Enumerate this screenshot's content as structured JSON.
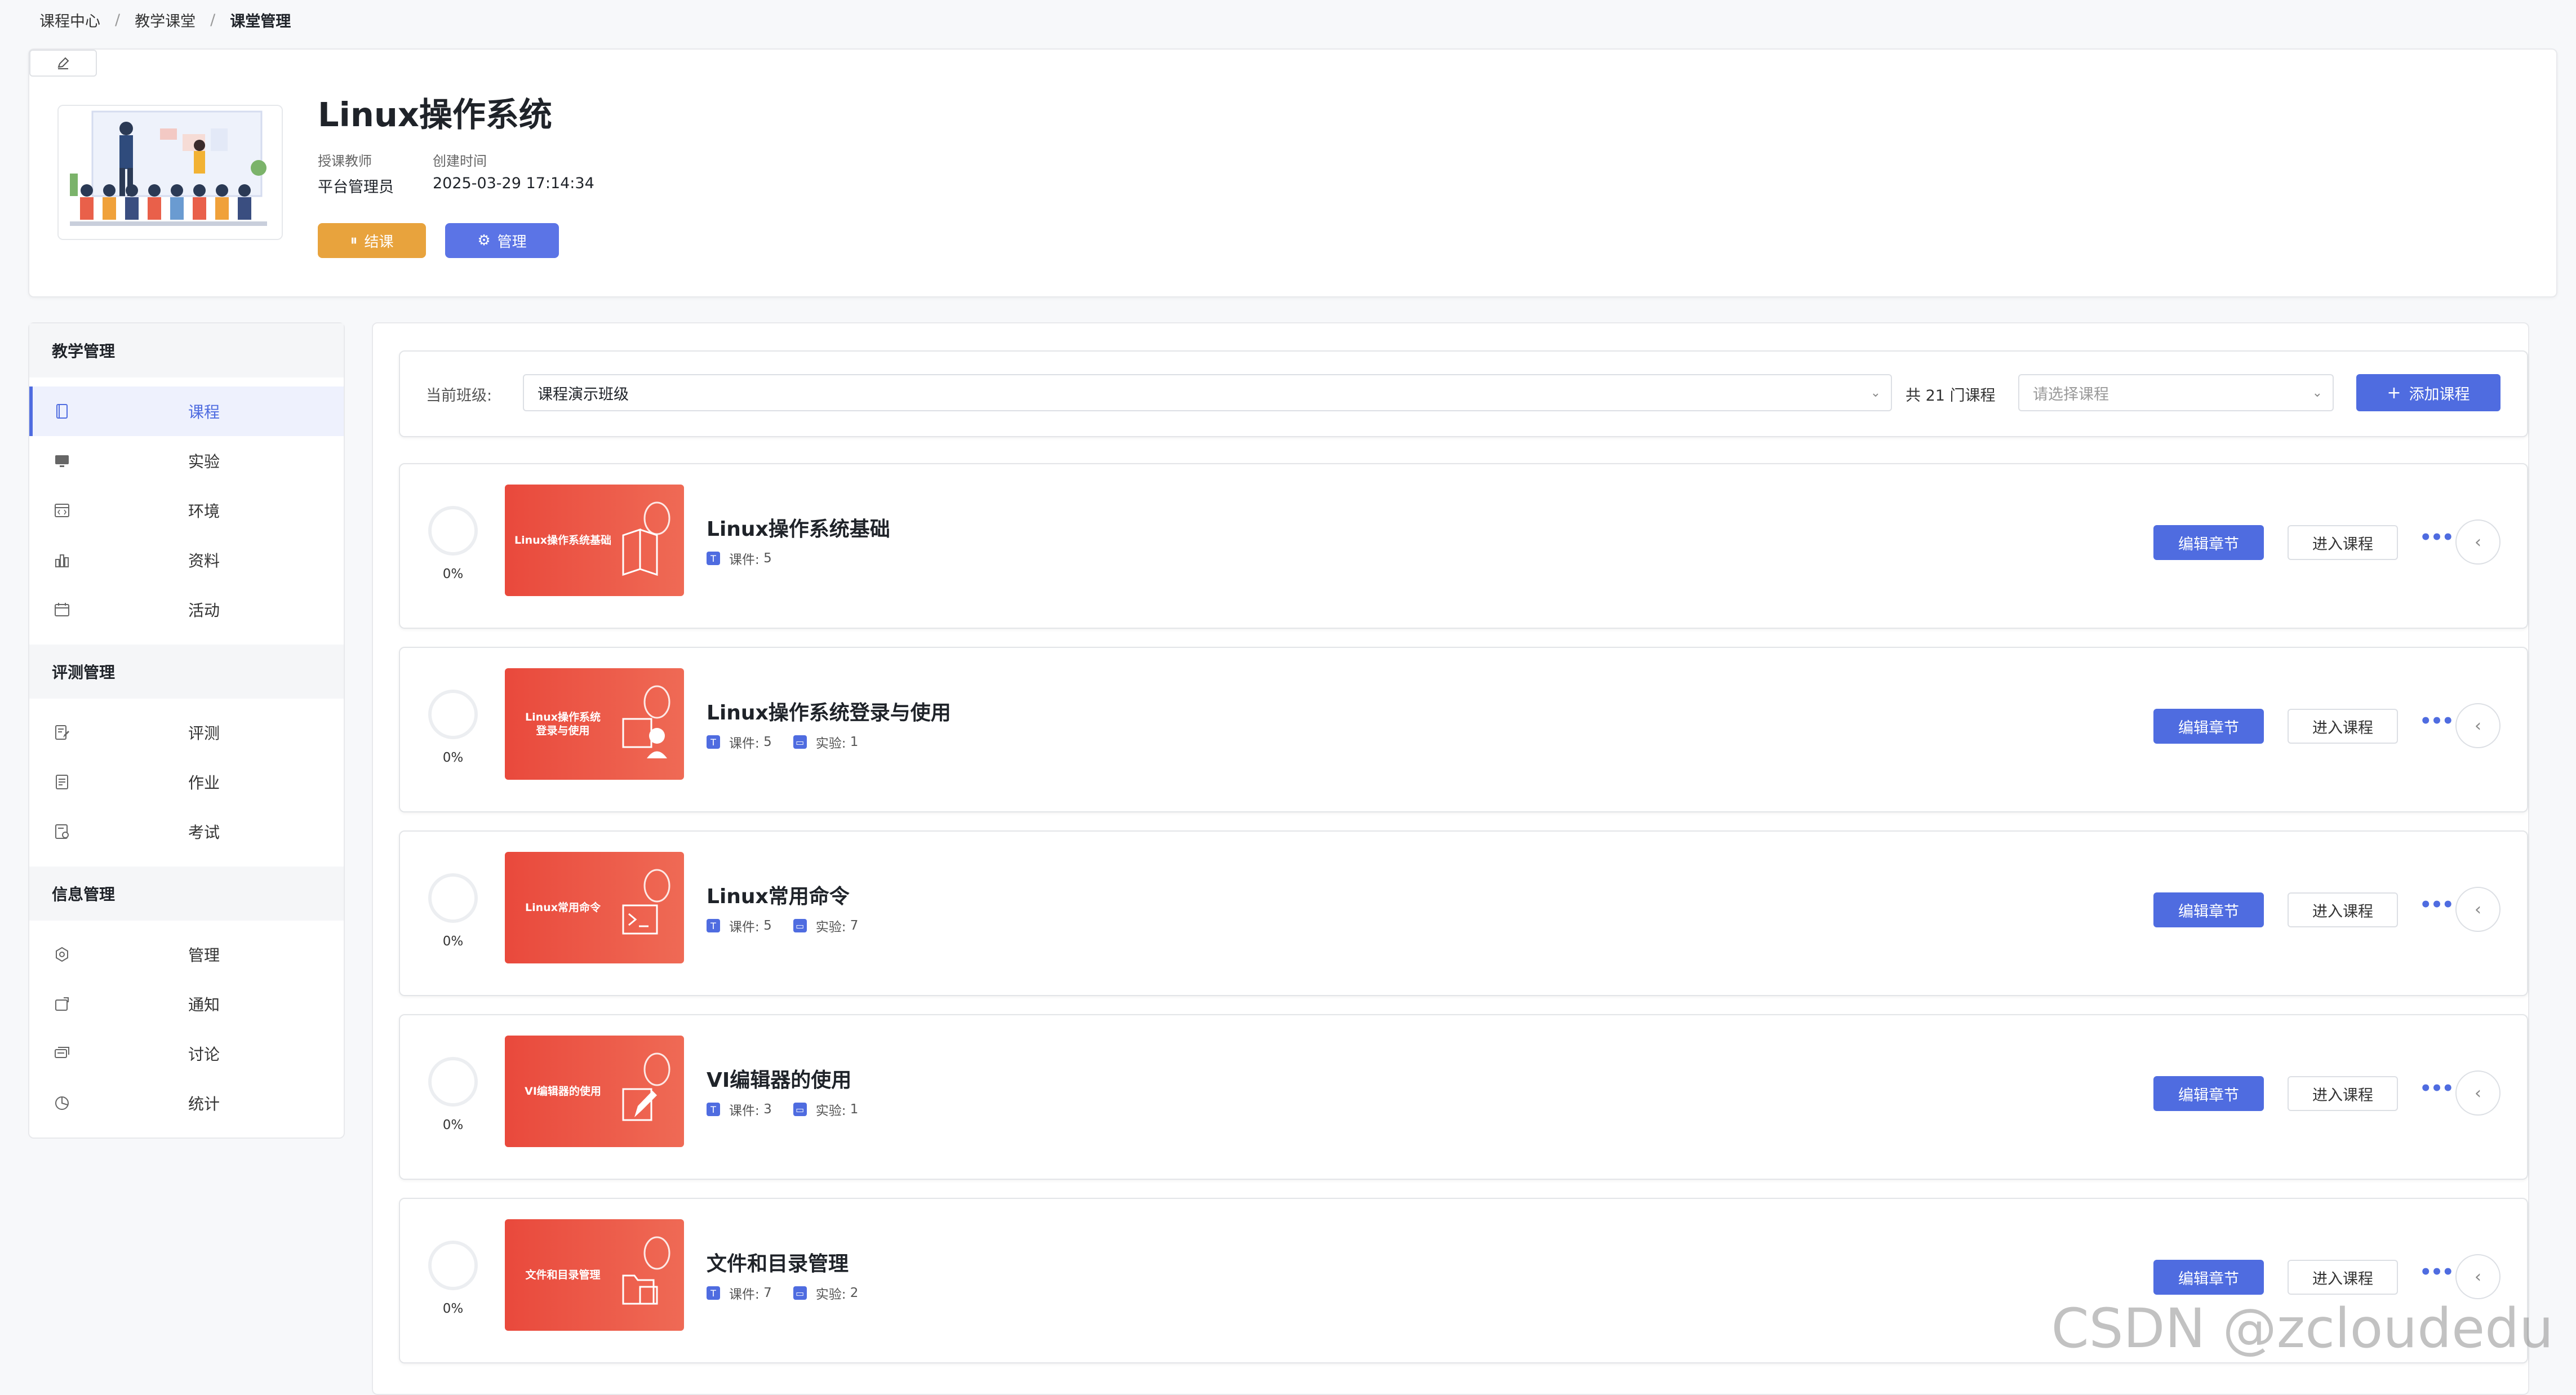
{
  "breadcrumb": [
    "课程中心",
    "教学课堂",
    "课堂管理"
  ],
  "header": {
    "title": "Linux操作系统",
    "teacher_label": "授课教师",
    "teacher_value": "平台管理员",
    "created_label": "创建时间",
    "created_value": "2025-03-29 17:14:34",
    "end_button": "结课",
    "manage_button": "管理",
    "end_button_color": "#e8a33d",
    "manage_button_color": "#5b74e6"
  },
  "sidebar": {
    "sections": [
      {
        "title": "教学管理",
        "items": [
          {
            "label": "课程",
            "icon": "book-icon",
            "active": true
          },
          {
            "label": "实验",
            "icon": "monitor-icon"
          },
          {
            "label": "环境",
            "icon": "code-window-icon"
          },
          {
            "label": "资料",
            "icon": "bar-chart-icon"
          },
          {
            "label": "活动",
            "icon": "calendar-icon"
          }
        ]
      },
      {
        "title": "评测管理",
        "items": [
          {
            "label": "评测",
            "icon": "edit-doc-icon"
          },
          {
            "label": "作业",
            "icon": "document-icon"
          },
          {
            "label": "考试",
            "icon": "exam-icon"
          }
        ]
      },
      {
        "title": "信息管理",
        "items": [
          {
            "label": "管理",
            "icon": "gear-icon"
          },
          {
            "label": "通知",
            "icon": "notice-icon"
          },
          {
            "label": "讨论",
            "icon": "chat-icon"
          },
          {
            "label": "统计",
            "icon": "pie-chart-icon"
          }
        ]
      }
    ]
  },
  "filter": {
    "class_label": "当前班级:",
    "class_value": "课程演示班级",
    "count_text": "共 21 门课程",
    "course_placeholder": "请选择课程",
    "add_button": "添加课程"
  },
  "accent_color": "#4f6ce0",
  "courses": [
    {
      "progress": "0%",
      "thumb_text": "Linux操作系统基础",
      "title": "Linux操作系统基础",
      "courseware_label": "课件:",
      "courseware": "5",
      "lab_label": "",
      "lab": "",
      "edit_label": "编辑章节",
      "enter_label": "进入课程",
      "thumb_icon": "book-icon"
    },
    {
      "progress": "0%",
      "thumb_text": "Linux操作系统\n登录与使用",
      "title": "Linux操作系统登录与使用",
      "courseware_label": "课件:",
      "courseware": "5",
      "lab_label": "实验:",
      "lab": "1",
      "edit_label": "编辑章节",
      "enter_label": "进入课程",
      "thumb_icon": "user-grid-icon"
    },
    {
      "progress": "0%",
      "thumb_text": "Linux常用命令",
      "title": "Linux常用命令",
      "courseware_label": "课件:",
      "courseware": "5",
      "lab_label": "实验:",
      "lab": "7",
      "edit_label": "编辑章节",
      "enter_label": "进入课程",
      "thumb_icon": "terminal-icon"
    },
    {
      "progress": "0%",
      "thumb_text": "VI编辑器的使用",
      "title": "VI编辑器的使用",
      "courseware_label": "课件:",
      "courseware": "3",
      "lab_label": "实验:",
      "lab": "1",
      "edit_label": "编辑章节",
      "enter_label": "进入课程",
      "thumb_icon": "pen-icon"
    },
    {
      "progress": "0%",
      "thumb_text": "文件和目录管理",
      "title": "文件和目录管理",
      "courseware_label": "课件:",
      "courseware": "7",
      "lab_label": "实验:",
      "lab": "2",
      "edit_label": "编辑章节",
      "enter_label": "进入课程",
      "thumb_icon": "folder-icon"
    }
  ],
  "watermark": "CSDN @zcloudedu"
}
